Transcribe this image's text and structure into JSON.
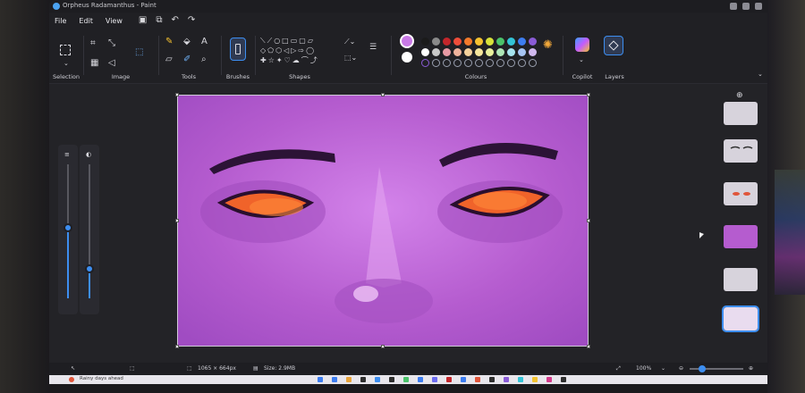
{
  "window": {
    "title": "Orpheus Radamanthus - Paint"
  },
  "menu": {
    "file": "File",
    "edit": "Edit",
    "view": "View"
  },
  "ribbon": {
    "groups": {
      "selection": "Selection",
      "image": "Image",
      "tools": "Tools",
      "brushes": "Brushes",
      "shapes": "Shapes",
      "colours": "Colours",
      "copilot": "Copilot",
      "layers": "Layers"
    },
    "palette_row1": [
      "#1b1b1b",
      "#8a8a8a",
      "#c3262b",
      "#ef4d3a",
      "#f27a2b",
      "#f6c230",
      "#d8e23a",
      "#4bc26a",
      "#33c3d6",
      "#3d7df0",
      "#8a5bd6"
    ],
    "palette_row2": [
      "#ffffff",
      "#c8c8c8",
      "#e89aa4",
      "#f0b39c",
      "#f6d29c",
      "#f6e69c",
      "#e8f09c",
      "#aee6b6",
      "#a6e3ee",
      "#a6c4f2",
      "#d0b8ee"
    ],
    "active_color_primary": "#c979e6",
    "active_color_secondary": "#ffffff"
  },
  "status": {
    "dimensions": "1065 × 664px",
    "size": "Size: 2.9MB",
    "zoom": "100%"
  },
  "taskbar": {
    "weather": "Rainy days ahead"
  },
  "icons": [
    "app-icon",
    "save-icon",
    "undo-icon",
    "redo-icon",
    "select-icon",
    "crop-icon",
    "rotate-icon",
    "pencil-icon",
    "fill-icon",
    "text-icon",
    "eraser-icon",
    "picker-icon",
    "magnifier-icon",
    "brush-icon",
    "colour-wheel-icon",
    "copilot-icon",
    "layers-icon",
    "add-layer-icon"
  ]
}
